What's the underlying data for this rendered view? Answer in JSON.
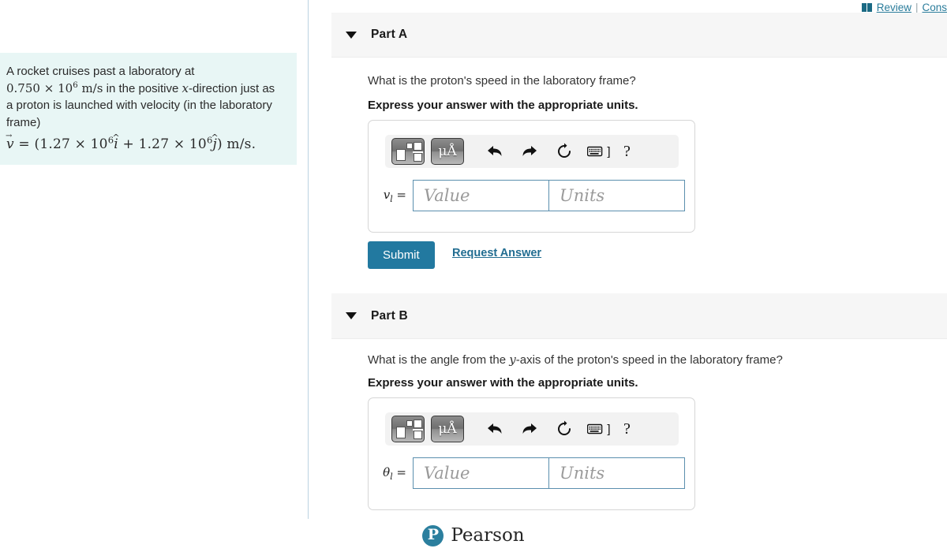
{
  "header": {
    "book_icon": "book-icon",
    "review_label": "Review",
    "separator": "|",
    "constants_label": "Cons"
  },
  "problem": {
    "line1": "A rocket cruises past a laboratory at",
    "speed_value": "0.750",
    "times": "×",
    "base": "10",
    "exponent": "6",
    "units": "m/s",
    "line2_tail": " in the positive ",
    "x_var": "x",
    "line2_end": "-direction just as",
    "line3": "a proton is launched with velocity (in the laboratory",
    "line4": "frame)",
    "eq_v": "v",
    "eq_equals": "=",
    "eq_open": "(",
    "eq_c1": "1.27",
    "eq_times1": "×",
    "eq_base1": "10",
    "eq_exp1": "6",
    "eq_i": "i",
    "eq_plus": "+",
    "eq_c2": "1.27",
    "eq_times2": "×",
    "eq_base2": "10",
    "eq_exp2": "6",
    "eq_j": "j",
    "eq_close": ")",
    "eq_units": "m/s."
  },
  "toolbar": {
    "template_button": "math-template-button",
    "units_button_label": "μÅ",
    "undo_icon": "undo-arrow-icon",
    "redo_icon": "redo-arrow-icon",
    "reset_icon": "reset-circle-icon",
    "keyboard_icon": "keyboard-icon",
    "keyboard_bracket": "]",
    "help_label": "?"
  },
  "parts": [
    {
      "id": "part-a",
      "title": "Part A",
      "question": "What is the proton's speed in the laboratory frame?",
      "instruction": "Express your answer with the appropriate units.",
      "variable": "v",
      "subscript": "l",
      "equals": "=",
      "value_placeholder": "Value",
      "units_placeholder": "Units",
      "value_current": "",
      "units_current": "",
      "submit_label": "Submit",
      "request_answer_label": "Request Answer"
    },
    {
      "id": "part-b",
      "title": "Part B",
      "question_pre": "What is the angle from the ",
      "question_var": "y",
      "question_post": "-axis of the proton's speed in the laboratory frame?",
      "question": "What is the angle from the y-axis of the proton's speed in the laboratory frame?",
      "instruction": "Express your answer with the appropriate units.",
      "variable": "θ",
      "subscript": "l",
      "equals": "=",
      "value_placeholder": "Value",
      "units_placeholder": "Units",
      "value_current": "",
      "units_current": ""
    }
  ],
  "footer": {
    "logo_mark": "P",
    "brand": "Pearson"
  },
  "colors": {
    "accent": "#2279a0",
    "link": "#226d91",
    "problem_bg": "#e8f6f5",
    "band_bg": "#f6f6f6",
    "field_border": "#5b8fae",
    "divider": "#bcd3e2"
  }
}
